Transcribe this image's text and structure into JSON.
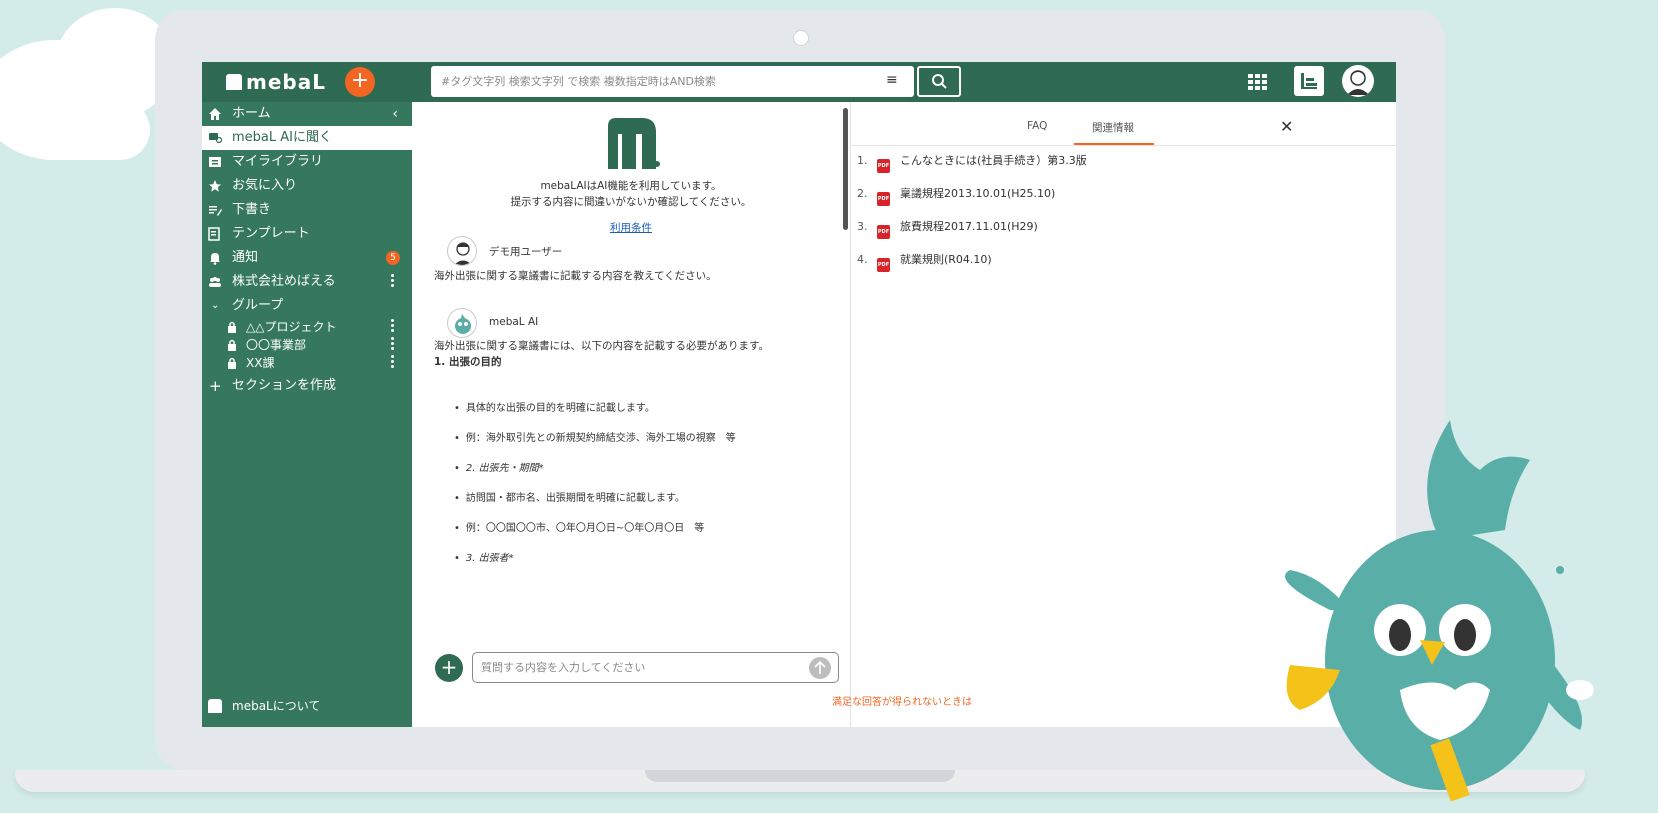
{
  "app": {
    "logo_text": "mebaL"
  },
  "search": {
    "placeholder": "#タグ文字列 検索文字列 で検索 複数指定時はAND検索"
  },
  "sidebar": {
    "items": [
      {
        "label": "ホーム"
      },
      {
        "label": "mebaL AIに聞く"
      },
      {
        "label": "マイライブラリ"
      },
      {
        "label": "お気に入り"
      },
      {
        "label": "下書き"
      },
      {
        "label": "テンプレート"
      },
      {
        "label": "通知",
        "badge": "5"
      },
      {
        "label": "株式会社めばえる"
      },
      {
        "label": "グループ"
      }
    ],
    "groups": [
      {
        "label": "△△プロジェクト"
      },
      {
        "label": "〇〇事業部"
      },
      {
        "label": "XX課"
      }
    ],
    "create_section": "セクションを作成",
    "about": "mebaLについて"
  },
  "chat": {
    "notice_line1": "mebaLAIはAI機能を利用しています。",
    "notice_line2": "提示する内容に間違いがないか確認してください。",
    "terms_link": "利用条件",
    "user_name": "デモ用ユーザー",
    "user_message": "海外出張に関する稟議書に記載する内容を教えてください。",
    "ai_name": "mebaL AI",
    "ai_message": "海外出張に関する稟議書には、以下の内容を記載する必要があります。",
    "ai_heading": "1. 出張の目的",
    "bullets": [
      "具体的な出張の目的を明確に記載します。",
      "例：海外取引先との新規契約締結交渉、海外工場の視察　等",
      "2. 出張先・期間*",
      "訪問国・都市名、出張期間を明確に記載します。",
      "例：〇〇国〇〇市、〇年〇月〇日~〇年〇月〇日　等",
      "3. 出張者*"
    ],
    "input_placeholder": "質問する内容を入力してください",
    "bottom_link": "満足な回答が得られないときは"
  },
  "right_panel": {
    "tabs": [
      "FAQ",
      "関連情報"
    ],
    "active_tab": "関連情報",
    "documents": [
      {
        "num": "1.",
        "title": "こんなときには(社員手続き）第3.3版"
      },
      {
        "num": "2.",
        "title": "稟議規程2013.10.01(H25.10)"
      },
      {
        "num": "3.",
        "title": "旅費規程2017.11.01(H29)"
      },
      {
        "num": "4.",
        "title": "就業規則(R04.10)"
      }
    ]
  },
  "colors": {
    "brand_green": "#2f6a52",
    "sidebar_green": "#36785e",
    "accent_orange": "#f26522",
    "pdf_red": "#d6242a"
  }
}
